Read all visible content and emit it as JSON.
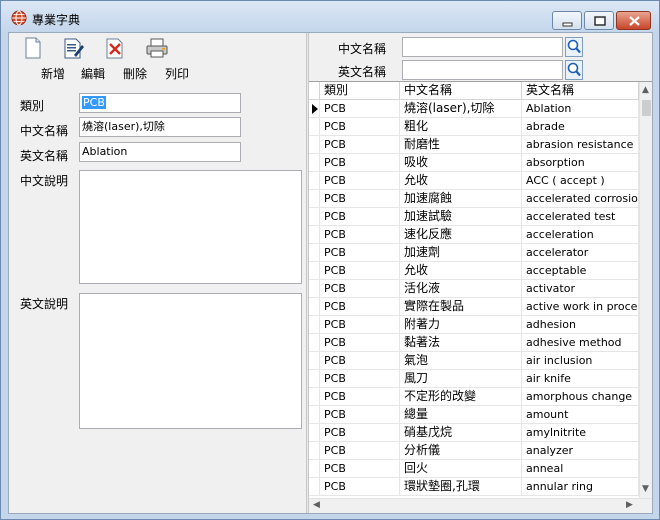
{
  "window": {
    "title": "專業字典",
    "minimize_label": "Minimize",
    "maximize_label": "Maximize",
    "close_label": "Close"
  },
  "toolbar": {
    "new_label": "新增",
    "edit_label": "編輯",
    "delete_label": "刪除",
    "print_label": "列印"
  },
  "form": {
    "category_label": "類別",
    "category_value": "PCB",
    "chinese_name_label": "中文名稱",
    "chinese_name_value": "燒溶(laser),切除",
    "english_name_label": "英文名稱",
    "english_name_value": "Ablation",
    "chinese_desc_label": "中文說明",
    "english_desc_label": "英文說明"
  },
  "search": {
    "chinese_name_label": "中文名稱",
    "english_name_label": "英文名稱",
    "chinese_value": "",
    "english_value": ""
  },
  "grid": {
    "columns": [
      "類別",
      "中文名稱",
      "英文名稱"
    ],
    "rows": [
      [
        "PCB",
        "燒溶(laser),切除",
        "Ablation"
      ],
      [
        "PCB",
        "粗化",
        "abrade"
      ],
      [
        "PCB",
        "耐磨性",
        "abrasion  resistance"
      ],
      [
        "PCB",
        "吸收",
        "absorption"
      ],
      [
        "PCB",
        "允收",
        "ACC ( accept )"
      ],
      [
        "PCB",
        "加速腐蝕",
        "accelerated corrosion test"
      ],
      [
        "PCB",
        "加速試驗",
        "accelerated test"
      ],
      [
        "PCB",
        "速化反應",
        "acceleration"
      ],
      [
        "PCB",
        "加速劑",
        "accelerator"
      ],
      [
        "PCB",
        "允收",
        "acceptable"
      ],
      [
        "PCB",
        "活化液",
        "activator"
      ],
      [
        "PCB",
        "實際在製品",
        "active work  in process"
      ],
      [
        "PCB",
        "附著力",
        "adhesion"
      ],
      [
        "PCB",
        "黏著法",
        "adhesive method"
      ],
      [
        "PCB",
        "氣泡",
        "air inclusion"
      ],
      [
        "PCB",
        "風刀",
        "air knife"
      ],
      [
        "PCB",
        "不定形的改變",
        "amorphous change"
      ],
      [
        "PCB",
        "總量",
        "amount"
      ],
      [
        "PCB",
        "硝基戊烷",
        "amylnitrite"
      ],
      [
        "PCB",
        "分析儀",
        "analyzer"
      ],
      [
        "PCB",
        "回火",
        "anneal"
      ],
      [
        "PCB",
        "環狀墊圈,孔環",
        "annular ring"
      ]
    ]
  },
  "colors": {
    "titlebar": "#c4d6ea",
    "selection": "#3399ff",
    "close_button": "#c8452b"
  }
}
